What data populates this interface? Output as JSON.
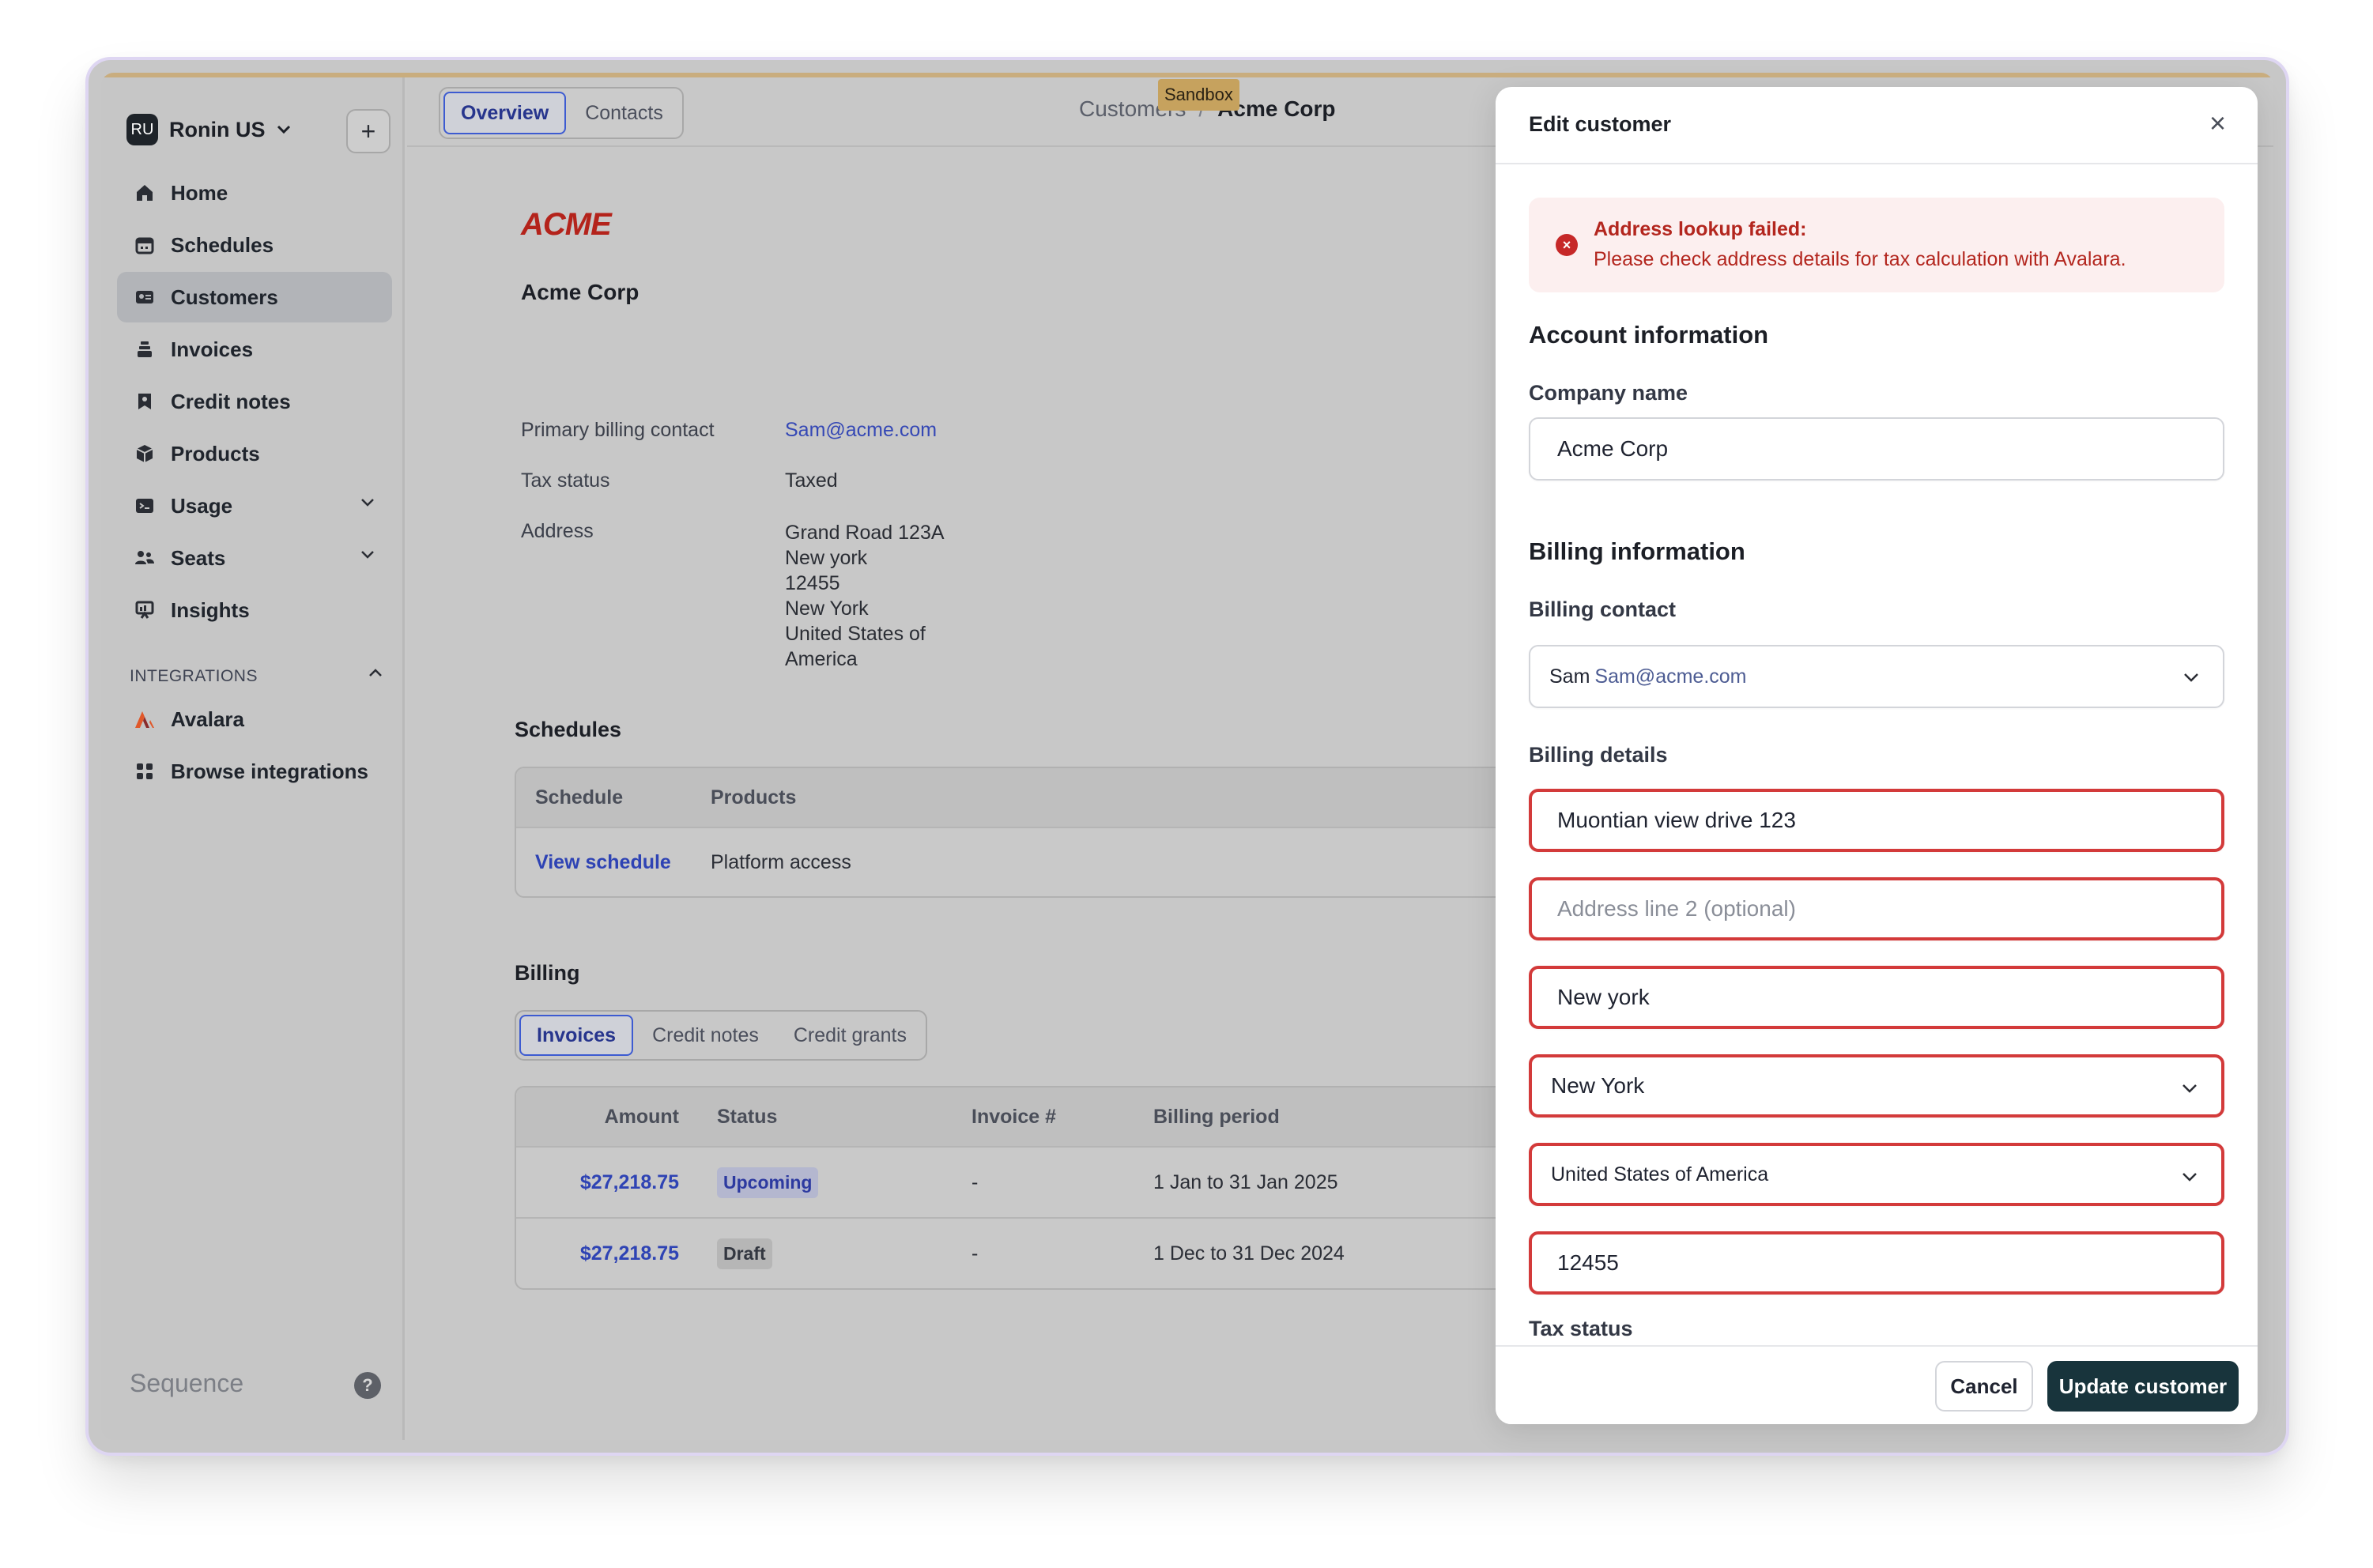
{
  "sidebar": {
    "org_initials": "RU",
    "org_name": "Ronin US",
    "nav": [
      {
        "label": "Home",
        "icon": "home-icon"
      },
      {
        "label": "Schedules",
        "icon": "calendar-icon"
      },
      {
        "label": "Customers",
        "icon": "id-card-icon",
        "active": true
      },
      {
        "label": "Invoices",
        "icon": "stack-icon"
      },
      {
        "label": "Credit notes",
        "icon": "note-icon"
      },
      {
        "label": "Products",
        "icon": "box-icon"
      },
      {
        "label": "Usage",
        "icon": "terminal-icon",
        "expandable": true
      },
      {
        "label": "Seats",
        "icon": "users-icon",
        "expandable": true
      },
      {
        "label": "Insights",
        "icon": "chart-icon"
      }
    ],
    "integrations_header": "INTEGRATIONS",
    "integrations": [
      {
        "label": "Avalara",
        "icon": "avalara-logo-icon"
      },
      {
        "label": "Browse integrations",
        "icon": "grid-icon"
      }
    ],
    "footer_brand": "Sequence",
    "help_glyph": "?"
  },
  "header": {
    "tabs": [
      "Overview",
      "Contacts"
    ],
    "active_tab": "Overview",
    "breadcrumb": [
      "Customers",
      "Acme Corp"
    ],
    "sandbox_label": "Sandbox"
  },
  "customer": {
    "logo_text": "ACME",
    "name": "Acme Corp",
    "fields": {
      "billing_contact_label": "Primary billing contact",
      "billing_contact_value": "Sam@acme.com",
      "tax_status_label": "Tax status",
      "tax_status_value": "Taxed",
      "address_label": "Address",
      "address_lines": [
        "Grand Road 123A",
        "New york",
        "12455",
        "New York",
        "United States of",
        "America"
      ]
    }
  },
  "schedules": {
    "title": "Schedules",
    "columns": [
      "Schedule",
      "Products"
    ],
    "rows": [
      {
        "schedule": "View schedule",
        "products": "Platform access"
      }
    ]
  },
  "billing": {
    "title": "Billing",
    "tabs": [
      "Invoices",
      "Credit notes",
      "Credit grants"
    ],
    "active_tab": "Invoices",
    "columns": [
      "Amount",
      "Status",
      "Invoice #",
      "Billing period"
    ],
    "rows": [
      {
        "amount": "$27,218.75",
        "status": "Upcoming",
        "invoice": "-",
        "period": "1 Jan to 31 Jan 2025"
      },
      {
        "amount": "$27,218.75",
        "status": "Draft",
        "invoice": "-",
        "period": "1 Dec to 31 Dec 2024"
      }
    ]
  },
  "modal": {
    "title": "Edit customer",
    "close_glyph": "×",
    "alert": {
      "title": "Address lookup failed:",
      "message": "Please check address details for tax calculation with Avalara."
    },
    "account_heading": "Account information",
    "company_name_label": "Company name",
    "company_name_value": "Acme Corp",
    "billing_heading": "Billing information",
    "billing_contact_label": "Billing contact",
    "billing_contact_name": "Sam",
    "billing_contact_email": "Sam@acme.com",
    "billing_details_label": "Billing details",
    "address_line1": "Muontian view drive 123",
    "address_line2_placeholder": "Address line 2 (optional)",
    "city": "New york",
    "state": "New York",
    "country": "United States of America",
    "postcode": "12455",
    "tax_status_label": "Tax status",
    "cancel_label": "Cancel",
    "update_label": "Update customer"
  },
  "colors": {
    "error_red": "#d33a3a",
    "primary_dark": "#18343c",
    "link_blue": "#3548b5",
    "sandbox_gold": "#c6a25e",
    "logo_red": "#b4231b"
  }
}
